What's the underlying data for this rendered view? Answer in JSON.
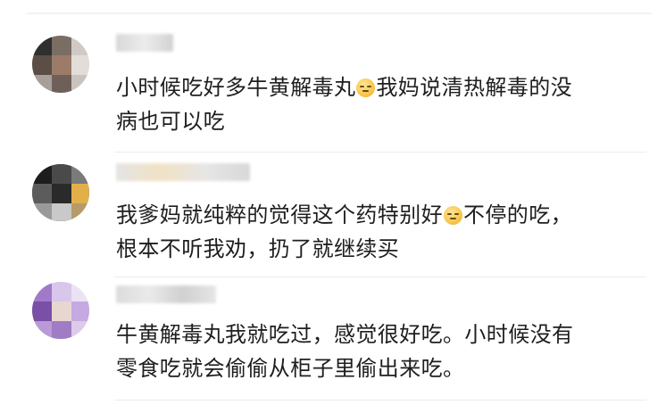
{
  "comments": [
    {
      "text_line1_before": "小时候吃好多牛黄解毒丸",
      "emoji1": "sleepy-face-emoji",
      "text_line1_after": "我妈说清热解毒的没",
      "text_line2": "病也可以吃"
    },
    {
      "text_line1_before": "我爹妈就纯粹的觉得这个药特别好",
      "emoji1": "thinking-face-emoji",
      "text_line1_after": "不停的吃，",
      "text_line2": "根本不听我劝，扔了就继续买"
    },
    {
      "text_line1": "牛黄解毒丸我就吃过，感觉很好吃。小时候没有",
      "text_line2": "零食吃就会偷偷从柜子里偷出来吃。"
    }
  ],
  "colors": {
    "text": "#1e1e1e",
    "divider": "#ececec",
    "emoji": "#f7c64a"
  }
}
